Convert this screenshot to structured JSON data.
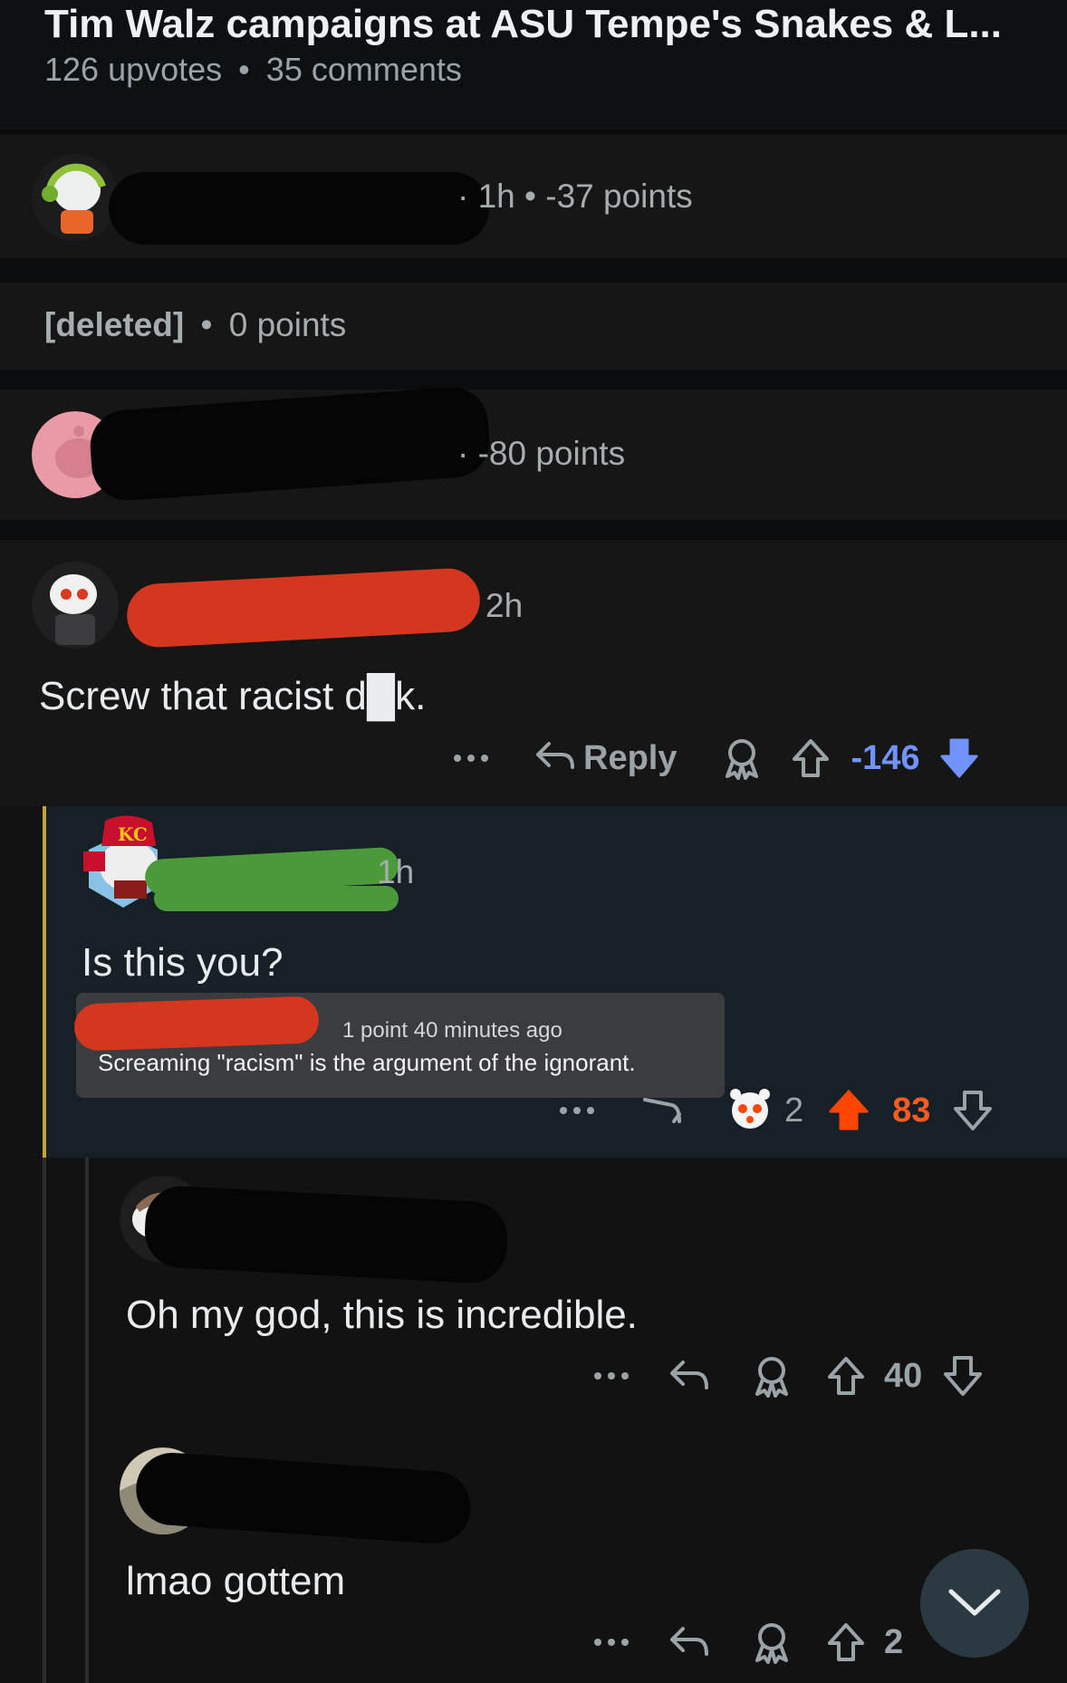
{
  "post": {
    "title": "Tim Walz campaigns at ASU Tempe's Snakes & L...",
    "upvotes": "126 upvotes",
    "comments": "35 comments",
    "dot": "•"
  },
  "comments": [
    {
      "meta_tail": "· 1h • -37 points"
    },
    {
      "author": "[deleted]",
      "dot": "•",
      "points": "0 points"
    },
    {
      "meta_tail": "· -80 points"
    },
    {
      "time": "2h",
      "body": "Screw that racist d█k.",
      "reply_label": "Reply",
      "score": "-146"
    },
    {
      "time": "1h",
      "body": "Is this you?",
      "quote": {
        "meta": "1 point 40 minutes ago",
        "text": "Screaming \"racism\" is the argument of the ignorant."
      },
      "award_count": "2",
      "score": "83"
    },
    {
      "body": "Oh my god, this is incredible.",
      "score": "40"
    },
    {
      "body": "lmao gottem",
      "score": "2"
    }
  ],
  "colors": {
    "downvote_blue": "#7193ff",
    "upvote_orange": "#ff4500",
    "thread_line": "#c6a339",
    "highlight_bg": "#172027"
  },
  "icons": [
    "more-icon",
    "reply-icon",
    "award-icon",
    "upvote-icon",
    "downvote-icon",
    "chevron-down-icon"
  ]
}
